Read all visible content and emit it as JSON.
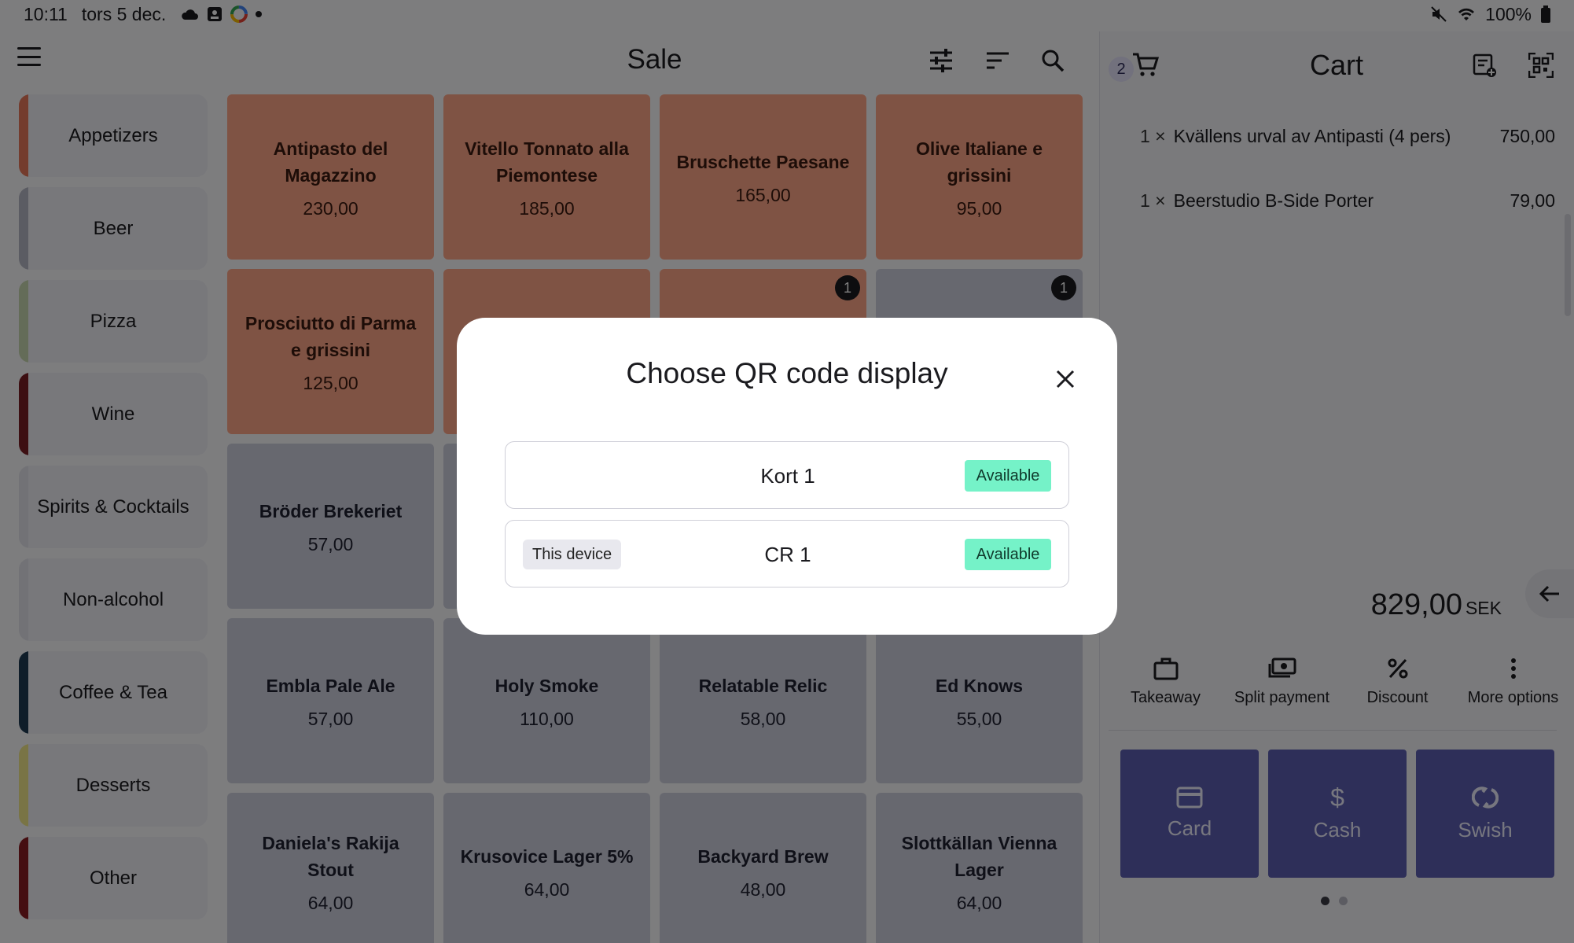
{
  "status_bar": {
    "time": "10:11",
    "date": "tors 5 dec.",
    "battery": "100%"
  },
  "header": {
    "title": "Sale"
  },
  "categories": [
    {
      "label": "Appetizers",
      "color": "#e8795a"
    },
    {
      "label": "Beer",
      "color": "#b7b8c6"
    },
    {
      "label": "Pizza",
      "color": "#c8d8b0"
    },
    {
      "label": "Wine",
      "color": "#7a1f24"
    },
    {
      "label": "Spirits & Cocktails",
      "color": "#e4e4ec"
    },
    {
      "label": "Non-alcohol",
      "color": "#e4e4ec"
    },
    {
      "label": "Coffee & Tea",
      "color": "#1f3a52"
    },
    {
      "label": "Desserts",
      "color": "#f2e88a"
    },
    {
      "label": "Other",
      "color": "#8a1d22"
    }
  ],
  "products": [
    {
      "name": "Antipasto del Magazzino",
      "price": "230,00",
      "color": "orange"
    },
    {
      "name": "Vitello Tonnato alla Piemontese",
      "price": "185,00",
      "color": "orange"
    },
    {
      "name": "Bruschette Paesane",
      "price": "165,00",
      "color": "orange"
    },
    {
      "name": "Olive Italiane e grissini",
      "price": "95,00",
      "color": "orange"
    },
    {
      "name": "Prosciutto di Parma e grissini",
      "price": "125,00",
      "color": "orange"
    },
    {
      "name": "",
      "price": "",
      "color": "orange"
    },
    {
      "name": "",
      "price": "",
      "color": "orange",
      "badge": "1"
    },
    {
      "name": "",
      "price": "",
      "color": "grey",
      "badge": "1"
    },
    {
      "name": "Bröder Brekeriet",
      "price": "57,00",
      "color": "grey"
    },
    {
      "name": "",
      "price": "",
      "color": "grey"
    },
    {
      "name": "",
      "price": "",
      "color": "grey"
    },
    {
      "name": "",
      "price": "",
      "color": "grey"
    },
    {
      "name": "Embla Pale Ale",
      "price": "57,00",
      "color": "grey"
    },
    {
      "name": "Holy Smoke",
      "price": "110,00",
      "color": "grey"
    },
    {
      "name": "Relatable Relic",
      "price": "58,00",
      "color": "grey"
    },
    {
      "name": "Ed Knows",
      "price": "55,00",
      "color": "grey"
    },
    {
      "name": "Daniela's Rakija Stout",
      "price": "64,00",
      "color": "grey"
    },
    {
      "name": "Krusovice Lager 5%",
      "price": "64,00",
      "color": "grey"
    },
    {
      "name": "Backyard Brew",
      "price": "48,00",
      "color": "grey"
    },
    {
      "name": "Slottkällan Vienna Lager",
      "price": "64,00",
      "color": "grey"
    }
  ],
  "cart": {
    "count": "2",
    "title": "Cart",
    "items": [
      {
        "qty": "1 ×",
        "name": "Kvällens urval av  Antipasti (4 pers)",
        "price": "750,00"
      },
      {
        "qty": "1 ×",
        "name": "Beerstudio B-Side Porter",
        "price": "79,00"
      }
    ],
    "total": "829,00",
    "currency": "SEK"
  },
  "actions": [
    {
      "label": "Takeaway",
      "icon": "bag-icon"
    },
    {
      "label": "Split payment",
      "icon": "split-payment-icon"
    },
    {
      "label": "Discount",
      "icon": "percent-icon"
    },
    {
      "label": "More options",
      "icon": "more-vertical-icon"
    }
  ],
  "payment_buttons": [
    {
      "label": "Card",
      "icon": "card-icon"
    },
    {
      "label": "Cash",
      "icon": "dollar-icon"
    },
    {
      "label": "Swish",
      "icon": "swish-icon"
    }
  ],
  "modal": {
    "title": "Choose QR code display",
    "options": [
      {
        "name": "Kort 1",
        "tag": "",
        "status": "Available"
      },
      {
        "name": "CR 1",
        "tag": "This device",
        "status": "Available"
      }
    ],
    "status_color": "#75f2c8"
  }
}
